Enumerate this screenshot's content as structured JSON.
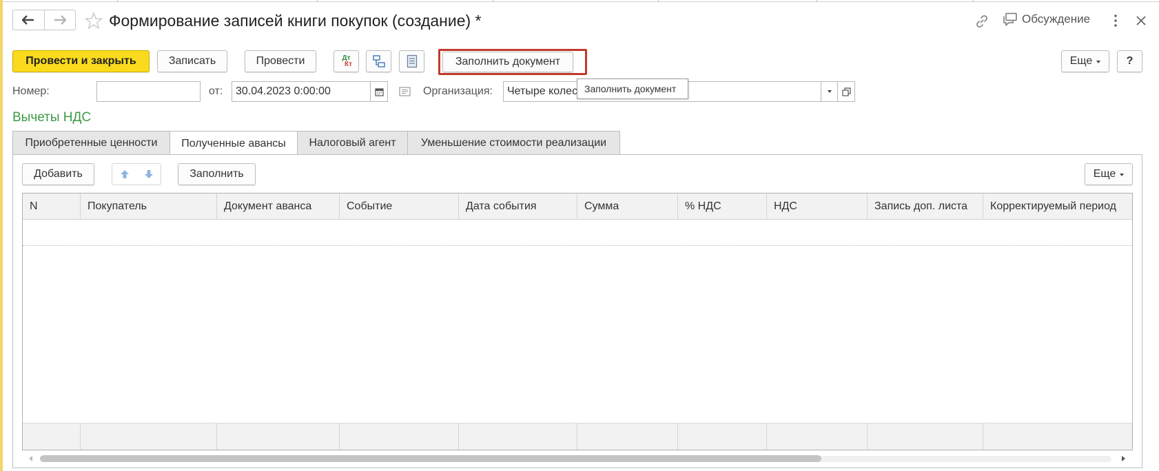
{
  "window": {
    "title": "Формирование записей книги покупок (создание) *",
    "discuss_label": "Обсуждение"
  },
  "toolbar": {
    "post_close_label": "Провести и закрыть",
    "save_label": "Записать",
    "post_label": "Провести",
    "dtkt_top": "Дт",
    "dtkt_bottom": "Кт",
    "fill_document_label": "Заполнить документ",
    "more_label": "Еще",
    "help_label": "?"
  },
  "tooltip": {
    "text": "Заполнить документ"
  },
  "form": {
    "number_label": "Номер:",
    "number_value": "",
    "date_label": "от:",
    "date_value": "30.04.2023  0:00:00",
    "org_label": "Организация:",
    "org_value": "Четыре колес"
  },
  "section": {
    "title": "Вычеты НДС"
  },
  "tabs": [
    {
      "label": "Приобретенные ценности",
      "active": false
    },
    {
      "label": "Полученные авансы",
      "active": true
    },
    {
      "label": "Налоговый агент",
      "active": false
    },
    {
      "label": "Уменьшение стоимости реализации",
      "active": false
    }
  ],
  "table_toolbar": {
    "add_label": "Добавить",
    "fill_label": "Заполнить",
    "more_label": "Еще"
  },
  "table": {
    "columns": [
      "N",
      "Покупатель",
      "Документ аванса",
      "Событие",
      "Дата события",
      "Сумма",
      "% НДС",
      "НДС",
      "Запись доп. листа",
      "Корректируемый период"
    ],
    "rows": []
  },
  "colors": {
    "primary_button": "#fada1c",
    "section_title": "#3c9a44",
    "highlight_frame": "#c0392b"
  }
}
